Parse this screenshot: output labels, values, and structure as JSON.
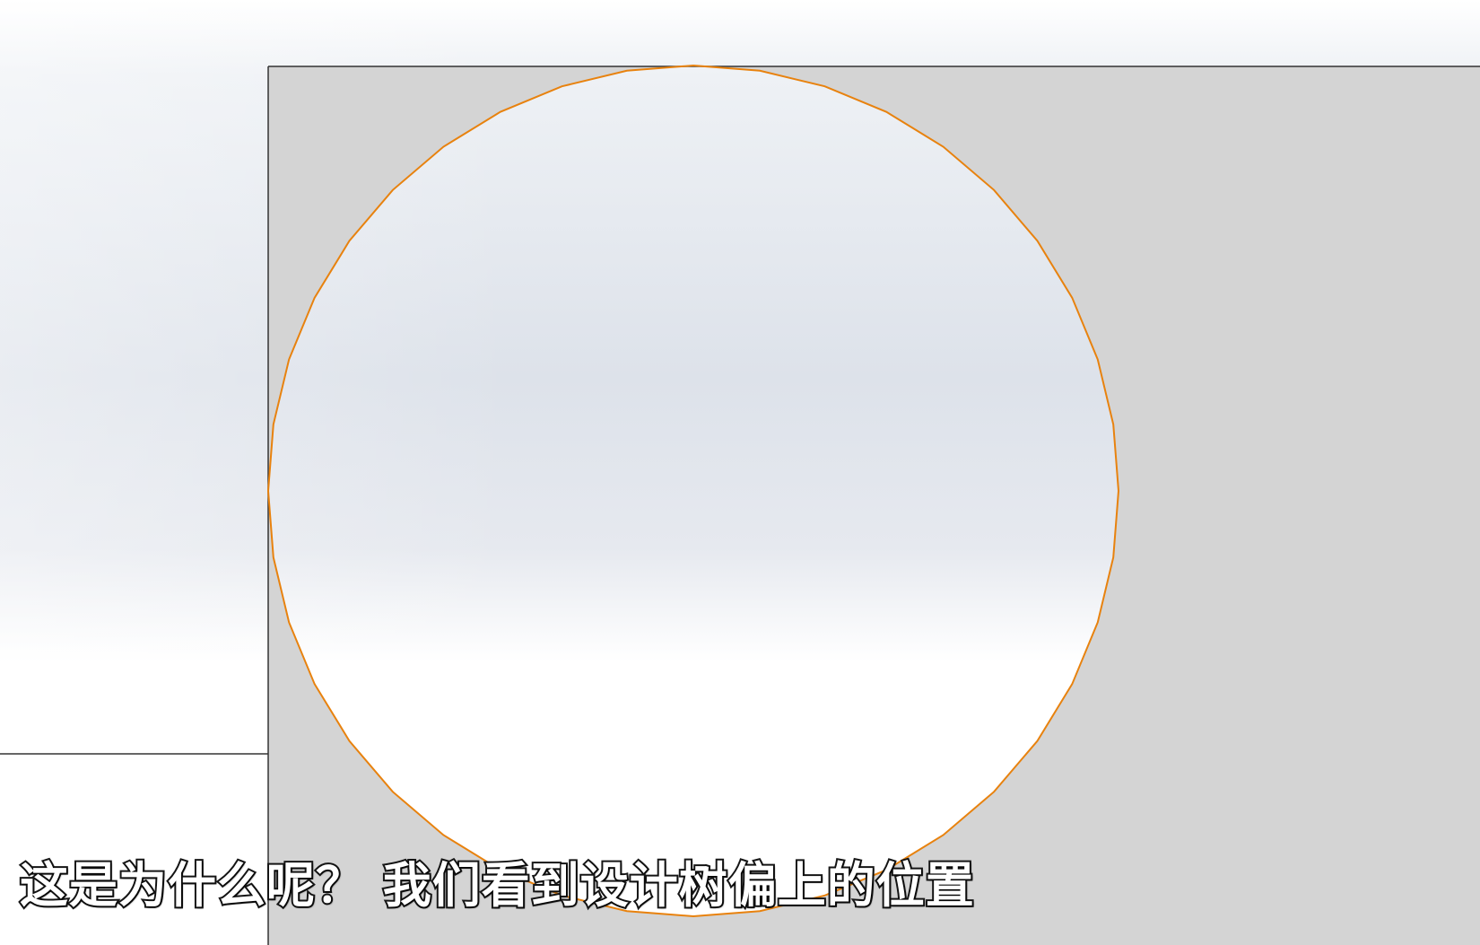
{
  "viewport": {
    "background_top_color": "#ffffff",
    "background_mid_color": "#dde2ea",
    "sketch_fill_color": "#d4d4d4",
    "sketch_line_color": "#333333",
    "circle_edge_color": "#e8820e",
    "circle_polygon_segments": 40
  },
  "subtitle": {
    "text": "这是为什么呢？ 我们看到设计树偏上的位置"
  }
}
